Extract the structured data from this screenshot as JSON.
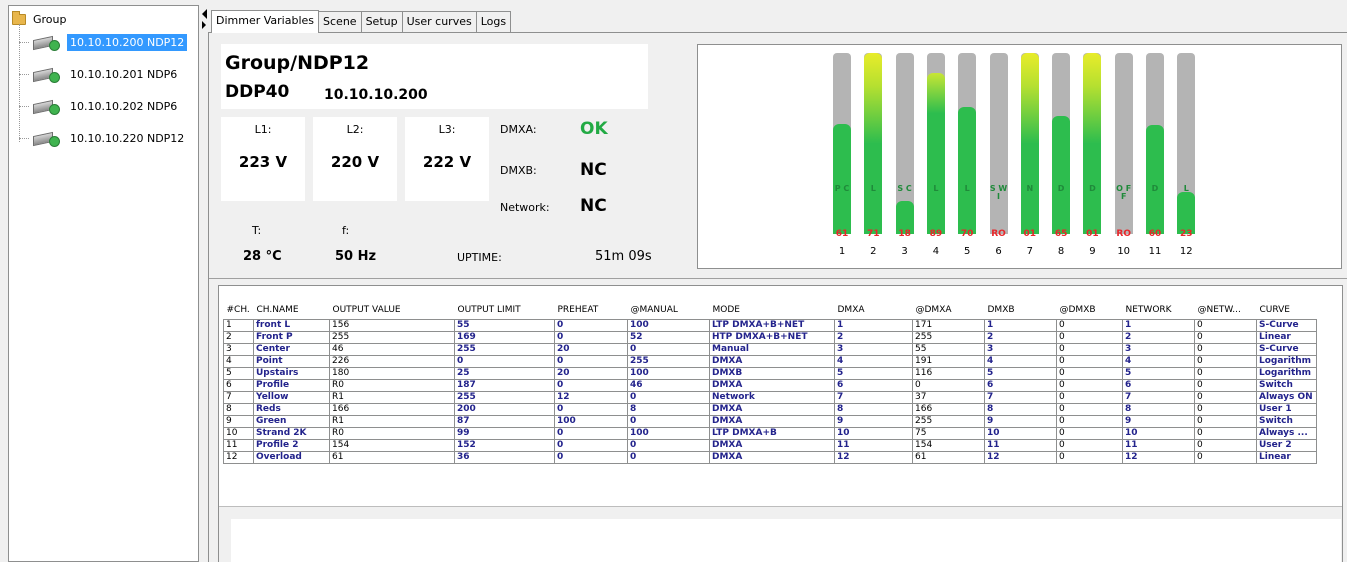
{
  "tree": {
    "root_label": "Group",
    "devices": [
      {
        "label": "10.10.10.200 NDP12",
        "selected": true
      },
      {
        "label": "10.10.10.201 NDP6",
        "selected": false
      },
      {
        "label": "10.10.10.202 NDP6",
        "selected": false
      },
      {
        "label": "10.10.10.220 NDP12",
        "selected": false
      }
    ]
  },
  "tabs": [
    "Dimmer Variables",
    "Scene",
    "Setup",
    "User curves",
    "Logs"
  ],
  "header": {
    "title": "Group/NDP12",
    "model": "DDP40",
    "ip": "10.10.10.200"
  },
  "voltages": [
    {
      "label": "L1:",
      "value": "223 V"
    },
    {
      "label": "L2:",
      "value": "220 V"
    },
    {
      "label": "L3:",
      "value": "222 V"
    }
  ],
  "status": {
    "dmxa_label": "DMXA:",
    "dmxa_value": "OK",
    "dmxb_label": "DMXB:",
    "dmxb_value": "NC",
    "network_label": "Network:",
    "network_value": "NC",
    "t_label": "T:",
    "t_value": "28 °C",
    "f_label": "f:",
    "f_value": "50 Hz",
    "uptime_label": "UPTIME:",
    "uptime_value": "51m 09s"
  },
  "colors": {
    "ok": "#22aa44",
    "bar_green": "#2dbd4e",
    "bar_yellow": "#e8ec2a",
    "bar_gray": "#b4b4b4",
    "value_red": "#e8262a"
  },
  "channels": [
    {
      "num": "1",
      "level": 0.61,
      "value": "61",
      "mark": "P C"
    },
    {
      "num": "2",
      "level": 1.0,
      "value": "71",
      "mark": "L"
    },
    {
      "num": "3",
      "level": 0.18,
      "value": "18",
      "mark": "S C"
    },
    {
      "num": "4",
      "level": 0.89,
      "value": "89",
      "mark": "L"
    },
    {
      "num": "5",
      "level": 0.7,
      "value": "70",
      "mark": "L"
    },
    {
      "num": "6",
      "level": 0.0,
      "value": "RO",
      "mark": "S W I"
    },
    {
      "num": "7",
      "level": 1.0,
      "value": "01",
      "mark": "N"
    },
    {
      "num": "8",
      "level": 0.65,
      "value": "65",
      "mark": "D"
    },
    {
      "num": "9",
      "level": 1.0,
      "value": "01",
      "mark": "D"
    },
    {
      "num": "10",
      "level": 0.0,
      "value": "RO",
      "mark": "O F F"
    },
    {
      "num": "11",
      "level": 0.6,
      "value": "60",
      "mark": "D"
    },
    {
      "num": "12",
      "level": 0.23,
      "value": "23",
      "mark": "L"
    }
  ],
  "table": {
    "headers": [
      "#CH.",
      "CH.NAME",
      "OUTPUT VALUE",
      "OUTPUT LIMIT",
      "PREHEAT",
      "@MANUAL",
      "MODE",
      "DMXA",
      "@DMXA",
      "DMXB",
      "@DMXB",
      "NETWORK",
      "@NETW...",
      "CURVE"
    ],
    "rows": [
      [
        "1",
        "front L",
        "156",
        "55",
        "0",
        "100",
        "LTP DMXA+B+NET",
        "1",
        "171",
        "1",
        "0",
        "1",
        "0",
        "S-Curve"
      ],
      [
        "2",
        "Front P",
        "255",
        "169",
        "0",
        "52",
        "HTP DMXA+B+NET",
        "2",
        "255",
        "2",
        "0",
        "2",
        "0",
        "Linear"
      ],
      [
        "3",
        "Center",
        "46",
        "255",
        "20",
        "0",
        "Manual",
        "3",
        "55",
        "3",
        "0",
        "3",
        "0",
        "S-Curve"
      ],
      [
        "4",
        "Point",
        "226",
        "0",
        "0",
        "255",
        "DMXA",
        "4",
        "191",
        "4",
        "0",
        "4",
        "0",
        "Logarithm"
      ],
      [
        "5",
        "Upstairs",
        "180",
        "25",
        "20",
        "100",
        "DMXB",
        "5",
        "116",
        "5",
        "0",
        "5",
        "0",
        "Logarithm"
      ],
      [
        "6",
        "Profile",
        "R0",
        "187",
        "0",
        "46",
        "DMXA",
        "6",
        "0",
        "6",
        "0",
        "6",
        "0",
        "Switch"
      ],
      [
        "7",
        "Yellow",
        "R1",
        "255",
        "12",
        "0",
        "Network",
        "7",
        "37",
        "7",
        "0",
        "7",
        "0",
        "Always ON"
      ],
      [
        "8",
        "Reds",
        "166",
        "200",
        "0",
        "8",
        "DMXA",
        "8",
        "166",
        "8",
        "0",
        "8",
        "0",
        "User 1"
      ],
      [
        "9",
        "Green",
        "R1",
        "87",
        "100",
        "0",
        "DMXA",
        "9",
        "255",
        "9",
        "0",
        "9",
        "0",
        "Switch"
      ],
      [
        "10",
        "Strand 2K",
        "R0",
        "99",
        "0",
        "100",
        "LTP DMXA+B",
        "10",
        "75",
        "10",
        "0",
        "10",
        "0",
        "Always ..."
      ],
      [
        "11",
        "Profile 2",
        "154",
        "152",
        "0",
        "0",
        "DMXA",
        "11",
        "154",
        "11",
        "0",
        "11",
        "0",
        "User 2"
      ],
      [
        "12",
        "Overload",
        "61",
        "36",
        "0",
        "0",
        "DMXA",
        "12",
        "61",
        "12",
        "0",
        "12",
        "0",
        "Linear"
      ]
    ]
  }
}
